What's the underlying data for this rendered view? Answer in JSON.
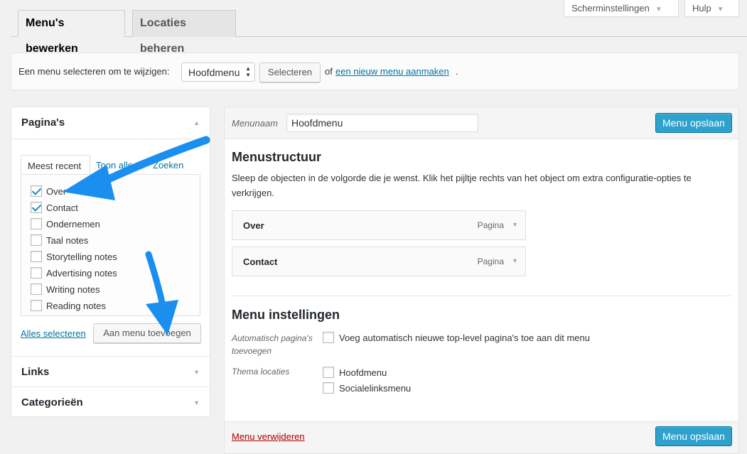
{
  "screen_meta": {
    "screen_options": "Scherminstellingen",
    "help": "Hulp"
  },
  "tabs": [
    {
      "label": "Menu's bewerken",
      "active": true
    },
    {
      "label": "Locaties beheren",
      "active": false
    }
  ],
  "manage": {
    "prompt": "Een menu selecteren om te wijzigen:",
    "selected_menu": "Hoofdmenu",
    "select_button": "Selecteren",
    "or_text": "of",
    "create_link": "een nieuw menu aanmaken",
    "period": "."
  },
  "left": {
    "pages_title": "Pagina's",
    "subtabs": [
      "Meest recent",
      "Toon alle",
      "Zoeken"
    ],
    "items": [
      {
        "label": "Over",
        "checked": true
      },
      {
        "label": "Contact",
        "checked": true
      },
      {
        "label": "Ondernemen",
        "checked": false
      },
      {
        "label": "Taal notes",
        "checked": false
      },
      {
        "label": "Storytelling notes",
        "checked": false
      },
      {
        "label": "Advertising notes",
        "checked": false
      },
      {
        "label": "Writing notes",
        "checked": false
      },
      {
        "label": "Reading notes",
        "checked": false
      }
    ],
    "select_all": "Alles selecteren",
    "add_button": "Aan menu toevoegen",
    "links_title": "Links",
    "categories_title": "Categorieën"
  },
  "right": {
    "name_label": "Menunaam",
    "name_value": "Hoofdmenu",
    "save_button": "Menu opslaan",
    "structure_title": "Menustructuur",
    "structure_desc": "Sleep de objecten in de volgorde die je wenst. Klik het pijltje rechts van het object om extra configuratie-opties te verkrijgen.",
    "menu_items": [
      {
        "title": "Over",
        "type": "Pagina"
      },
      {
        "title": "Contact",
        "type": "Pagina"
      }
    ],
    "settings_title": "Menu instellingen",
    "auto_add_label": "Automatisch pagina's toevoegen",
    "auto_add_option": "Voeg automatisch nieuwe top-level pagina's toe aan dit menu",
    "theme_locations_label": "Thema locaties",
    "locations": [
      "Hoofdmenu",
      "Socialelinksmenu"
    ],
    "delete_link": "Menu verwijderen"
  },
  "colors": {
    "accent": "#2ea2cc",
    "link": "#0074a2",
    "delete": "#a00",
    "annotation_arrow": "#1a8ff0"
  }
}
